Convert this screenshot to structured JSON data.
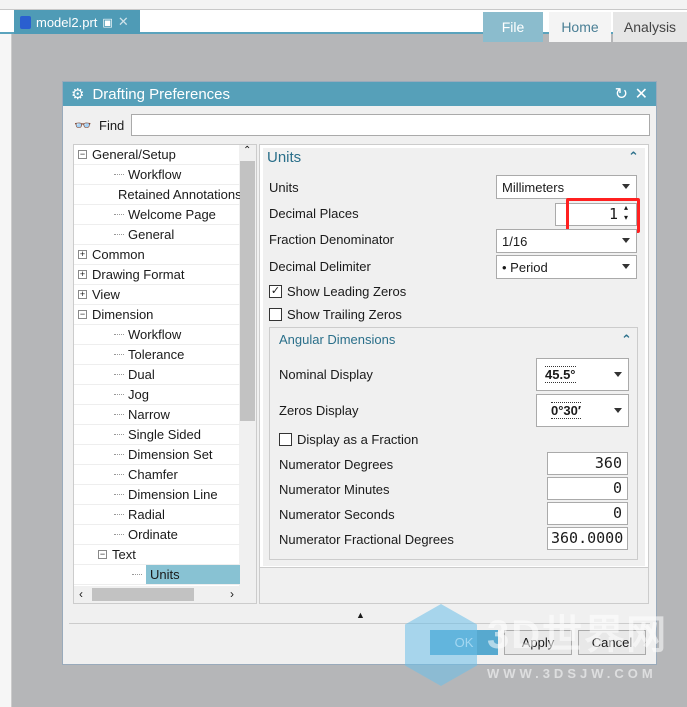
{
  "document_tab": {
    "name": "model2.prt"
  },
  "ribbon_tabs": [
    "File",
    "Home",
    "Analysis"
  ],
  "dialog": {
    "title": "Drafting Preferences",
    "find_label": "Find",
    "find_value": "",
    "tree": [
      {
        "label": "General/Setup",
        "level": 0,
        "toggle": "-"
      },
      {
        "label": "Workflow",
        "level": 1
      },
      {
        "label": "Retained Annotations",
        "level": 1
      },
      {
        "label": "Welcome Page",
        "level": 1
      },
      {
        "label": "General",
        "level": 1
      },
      {
        "label": "Common",
        "level": 0,
        "toggle": "+"
      },
      {
        "label": "Drawing Format",
        "level": 0,
        "toggle": "+"
      },
      {
        "label": "View",
        "level": 0,
        "toggle": "+"
      },
      {
        "label": "Dimension",
        "level": 0,
        "toggle": "-"
      },
      {
        "label": "Workflow",
        "level": 1
      },
      {
        "label": "Tolerance",
        "level": 1
      },
      {
        "label": "Dual",
        "level": 1
      },
      {
        "label": "Jog",
        "level": 1
      },
      {
        "label": "Narrow",
        "level": 1
      },
      {
        "label": "Single Sided",
        "level": 1
      },
      {
        "label": "Dimension Set",
        "level": 1
      },
      {
        "label": "Chamfer",
        "level": 1
      },
      {
        "label": "Dimension Line",
        "level": 1
      },
      {
        "label": "Radial",
        "level": 1
      },
      {
        "label": "Ordinate",
        "level": 1
      },
      {
        "label": "Text",
        "level": 1,
        "toggle": "-"
      },
      {
        "label": "Units",
        "level": 2,
        "selected": true
      }
    ],
    "units_section": {
      "title": "Units",
      "units_label": "Units",
      "units_value": "Millimeters",
      "decimal_places_label": "Decimal Places",
      "decimal_places_value": "1",
      "fraction_label": "Fraction Denominator",
      "fraction_value": "1/16",
      "delimiter_label": "Decimal Delimiter",
      "delimiter_value": "•  Period",
      "leading_zeros_label": "Show Leading Zeros",
      "leading_zeros_checked": true,
      "trailing_zeros_label": "Show Trailing Zeros",
      "trailing_zeros_checked": false
    },
    "angular": {
      "title": "Angular Dimensions",
      "nominal_label": "Nominal Display",
      "nominal_value": "45.5°",
      "zeros_label": "Zeros Display",
      "zeros_value": "0°30′",
      "fraction_label": "Display as a Fraction",
      "fraction_checked": false,
      "num_degrees_label": "Numerator Degrees",
      "num_degrees_value": "360",
      "num_minutes_label": "Numerator Minutes",
      "num_minutes_value": "0",
      "num_seconds_label": "Numerator Seconds",
      "num_seconds_value": "0",
      "num_frac_label": "Numerator Fractional Degrees",
      "num_frac_value": "360.0000"
    },
    "buttons": {
      "ok": "OK",
      "apply": "Apply",
      "cancel": "Cancel"
    }
  },
  "watermark": {
    "text": "3D世界网",
    "url": "WWW.3DSJW.COM"
  },
  "colors": {
    "accent": "#56a0b9",
    "selected": "#88c2d3",
    "highlight": "#ff2020"
  }
}
